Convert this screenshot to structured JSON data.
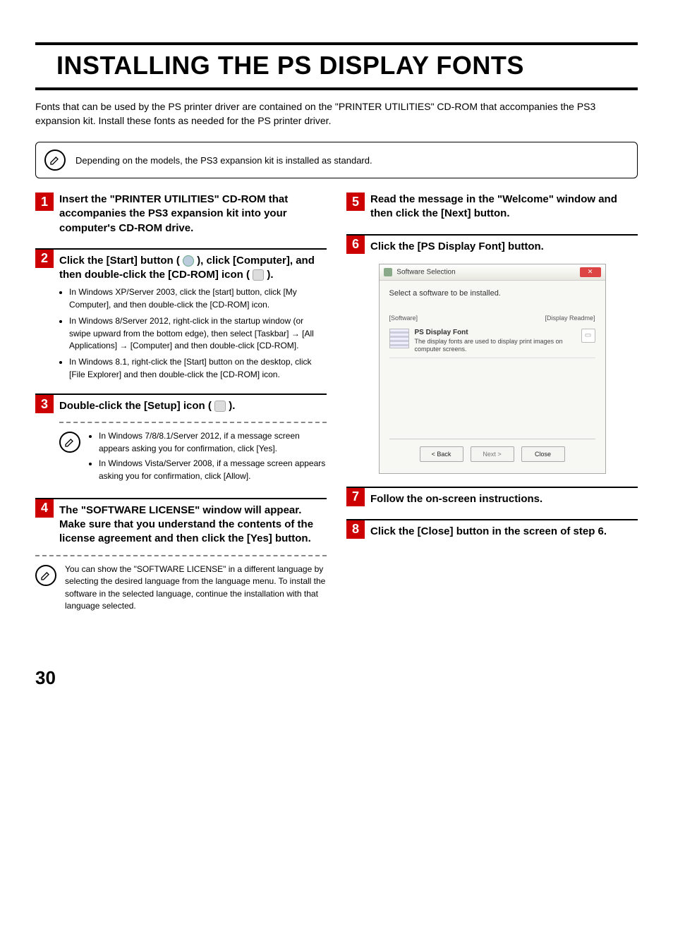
{
  "title": "INSTALLING THE PS DISPLAY FONTS",
  "intro": "Fonts that can be used by the PS printer driver are contained on the \"PRINTER UTILITIES\" CD-ROM that accompanies the PS3 expansion kit. Install these fonts as needed for the PS printer driver.",
  "top_note": "Depending on the models, the PS3 expansion kit is installed as standard.",
  "page_number": "30",
  "steps": {
    "s1": {
      "num": "1",
      "title": "Insert the \"PRINTER UTILITIES\" CD-ROM that accompanies the PS3 expansion kit into your computer's CD-ROM drive."
    },
    "s2": {
      "num": "2",
      "title_a": "Click the [Start] button (",
      "title_b": "), click [Computer], and then double-click the [CD-ROM] icon (",
      "title_c": ").",
      "bullets": [
        "In Windows XP/Server 2003, click the [start] button, click [My Computer], and then double-click the [CD-ROM] icon.",
        "In Windows 8/Server 2012, right-click in the startup window (or swipe upward from the bottom edge), then select [Taskbar] → [All Applications] → [Computer] and then double-click [CD-ROM].",
        "In Windows 8.1, right-click the [Start]  button on the desktop, click [File Explorer] and then double-click the [CD-ROM] icon."
      ]
    },
    "s3": {
      "num": "3",
      "title_a": "Double-click the [Setup] icon (",
      "title_b": ").",
      "note_bullets": [
        "In Windows 7/8/8.1/Server 2012, if a message screen appears asking you for confirmation, click [Yes].",
        "In Windows Vista/Server 2008, if a message screen appears asking you for confirmation, click [Allow]."
      ]
    },
    "s4": {
      "num": "4",
      "title": "The \"SOFTWARE LICENSE\" window will appear. Make sure that you understand the contents of the license agreement and then click the [Yes] button.",
      "note": "You can show the \"SOFTWARE LICENSE\" in a different language by selecting the desired language from the language menu. To install the software in the selected language, continue the installation with that language selected."
    },
    "s5": {
      "num": "5",
      "title": "Read the message in the \"Welcome\" window and then click the [Next] button."
    },
    "s6": {
      "num": "6",
      "title": "Click the [PS Display Font] button."
    },
    "s7": {
      "num": "7",
      "title": "Follow the on-screen instructions."
    },
    "s8": {
      "num": "8",
      "title": "Click the [Close] button in the screen of step 6."
    }
  },
  "dialog": {
    "window_title": "Software Selection",
    "instruction": "Select a software to be installed.",
    "col_left": "[Software]",
    "col_right": "[Display Readme]",
    "item_name": "PS Display Font",
    "item_desc": "The display fonts are used to display print images on computer screens.",
    "btn_back": "< Back",
    "btn_next": "Next >",
    "btn_close": "Close"
  }
}
